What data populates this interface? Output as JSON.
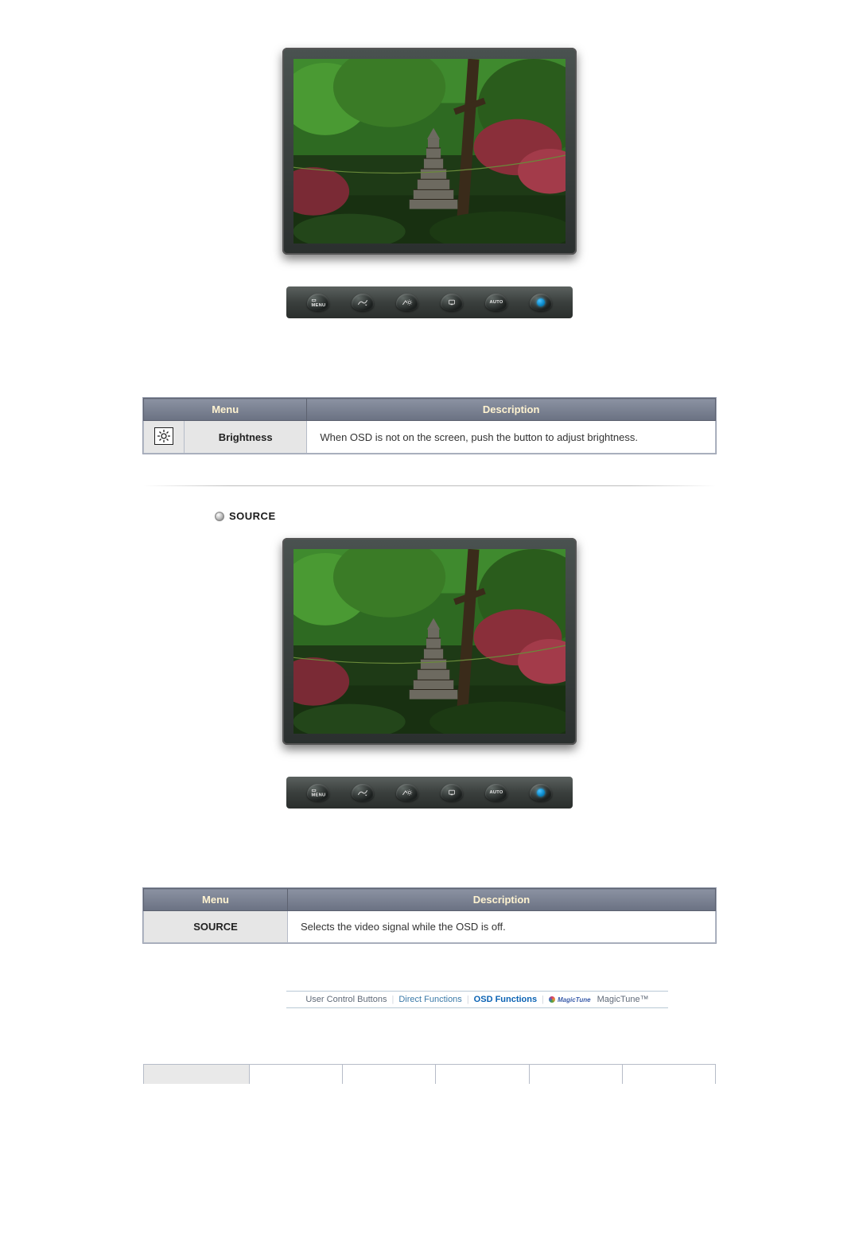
{
  "tables": {
    "header_menu": "Menu",
    "header_description": "Description",
    "brightness": {
      "name": "Brightness",
      "description": "When OSD is not on the screen, push the button to adjust brightness."
    },
    "source": {
      "name": "SOURCE",
      "description": "Selects the video signal while the OSD is off."
    }
  },
  "sections": {
    "source_heading": "SOURCE"
  },
  "buttons": {
    "menu": "MENU",
    "auto": "AUTO"
  },
  "nav": {
    "user_control": "User Control Buttons",
    "direct_functions": "Direct Functions",
    "osd_functions": "OSD Functions",
    "magictune": "MagicTune™",
    "logo_text": "MagicTune"
  }
}
